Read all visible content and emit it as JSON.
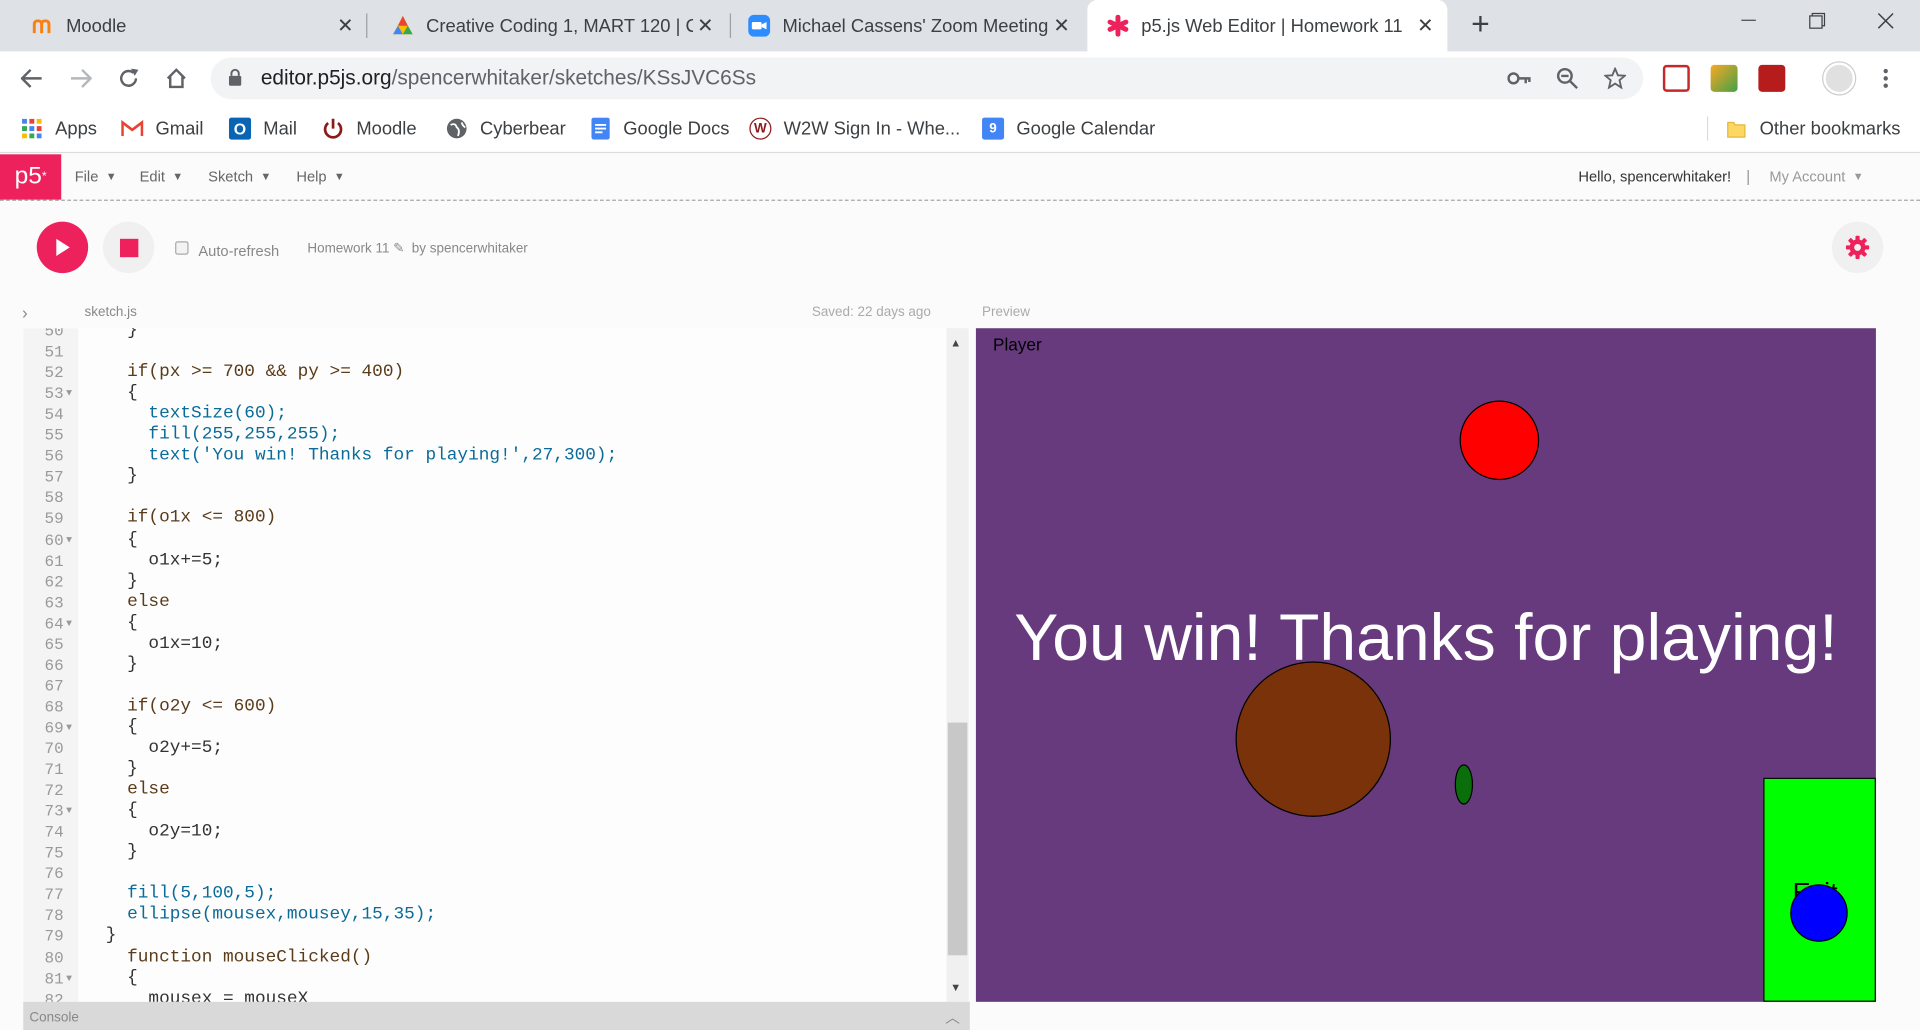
{
  "browser": {
    "tabs": [
      {
        "title": "Moodle",
        "icon": "moodle-icon"
      },
      {
        "title": "Creative Coding 1, MART 120 | Co",
        "icon": "google-icon"
      },
      {
        "title": "Michael Cassens' Zoom Meeting",
        "icon": "zoom-icon"
      },
      {
        "title": "p5.js Web Editor | Homework 11",
        "icon": "p5-asterisk-icon",
        "active": true
      }
    ],
    "url_host": "editor.p5js.org",
    "url_path": "/spencerwhitaker/sketches/KSsJVC6Ss",
    "bookmarks": [
      {
        "label": "Apps",
        "icon": "apps-grid-icon"
      },
      {
        "label": "Gmail",
        "icon": "gmail-icon"
      },
      {
        "label": "Mail",
        "icon": "outlook-icon"
      },
      {
        "label": "Moodle",
        "icon": "power-icon"
      },
      {
        "label": "Cyberbear",
        "icon": "globe-icon"
      },
      {
        "label": "Google Docs",
        "icon": "docs-icon"
      },
      {
        "label": "W2W Sign In - Whe...",
        "icon": "w2w-icon"
      },
      {
        "label": "Google Calendar",
        "icon": "calendar-icon"
      }
    ],
    "other_bookmarks": "Other bookmarks"
  },
  "editor": {
    "logo": "p5",
    "menus": [
      "File",
      "Edit",
      "Sketch",
      "Help"
    ],
    "greeting": "Hello, spencerwhitaker!",
    "separator": "|",
    "account": "My Account",
    "auto_refresh": "Auto-refresh",
    "project_name": "Homework 11",
    "project_owner": "by spencerwhitaker",
    "file_name": "sketch.js",
    "saved": "Saved: 22 days ago",
    "preview_label": "Preview",
    "console_label": "Console",
    "accent_color": "#ed225d"
  },
  "code_lines": [
    {
      "n": "50",
      "t": "    }"
    },
    {
      "n": "51",
      "t": ""
    },
    {
      "n": "52",
      "t": "    if(px >= 700 && py >= 400)"
    },
    {
      "n": "53",
      "t": "    {",
      "fold": true
    },
    {
      "n": "54",
      "t": "      textSize(60);"
    },
    {
      "n": "55",
      "t": "      fill(255,255,255);"
    },
    {
      "n": "56",
      "t": "      text('You win! Thanks for playing!',27,300);"
    },
    {
      "n": "57",
      "t": "    }"
    },
    {
      "n": "58",
      "t": ""
    },
    {
      "n": "59",
      "t": "    if(o1x <= 800)"
    },
    {
      "n": "60",
      "t": "    {",
      "fold": true
    },
    {
      "n": "61",
      "t": "      o1x+=5;"
    },
    {
      "n": "62",
      "t": "    }"
    },
    {
      "n": "63",
      "t": "    else"
    },
    {
      "n": "64",
      "t": "    {",
      "fold": true
    },
    {
      "n": "65",
      "t": "      o1x=10;"
    },
    {
      "n": "66",
      "t": "    }"
    },
    {
      "n": "67",
      "t": ""
    },
    {
      "n": "68",
      "t": "    if(o2y <= 600)"
    },
    {
      "n": "69",
      "t": "    {",
      "fold": true
    },
    {
      "n": "70",
      "t": "      o2y+=5;"
    },
    {
      "n": "71",
      "t": "    }"
    },
    {
      "n": "72",
      "t": "    else"
    },
    {
      "n": "73",
      "t": "    {",
      "fold": true
    },
    {
      "n": "74",
      "t": "      o2y=10;"
    },
    {
      "n": "75",
      "t": "    }"
    },
    {
      "n": "76",
      "t": ""
    },
    {
      "n": "77",
      "t": "    fill(5,100,5);"
    },
    {
      "n": "78",
      "t": "    ellipse(mousex,mousey,15,35);"
    },
    {
      "n": "79",
      "t": "  }"
    },
    {
      "n": "80",
      "t": "    function mouseClicked()"
    },
    {
      "n": "81",
      "t": "    {",
      "fold": true
    },
    {
      "n": "82",
      "t": "      mousex = mouseX"
    }
  ],
  "preview": {
    "player_label": "Player",
    "win_text": "You win! Thanks for playing!",
    "exit_label": "Exit",
    "background": "#663a7c",
    "colors": {
      "red": "#ff0000",
      "brown": "#7a320a",
      "green": "#0a6e0a",
      "blue": "#0000ff",
      "exit": "#00ff00"
    }
  }
}
